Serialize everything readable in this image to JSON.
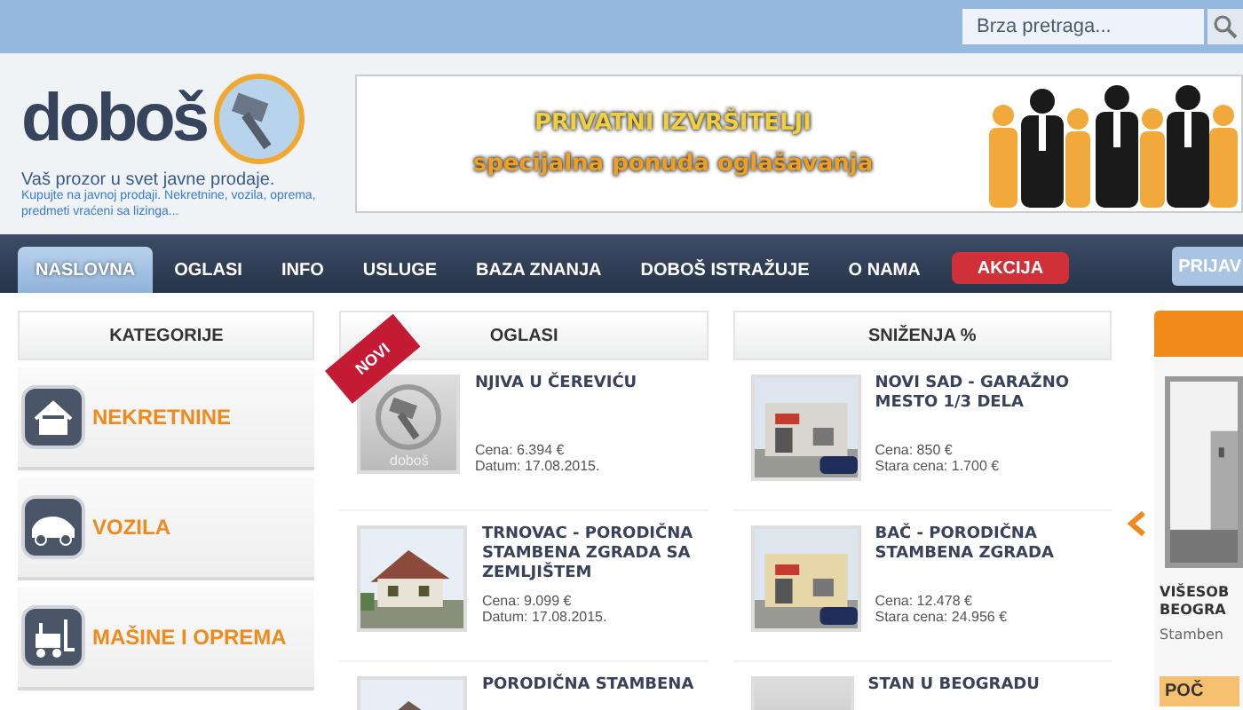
{
  "search": {
    "placeholder": "Brza pretraga..."
  },
  "logo": {
    "name": "doboš",
    "tagline": "Vaš prozor u svet javne prodaje.",
    "subtext": "Kupujte na javnoj prodaji. Nekretnine, vozila, oprema, predmeti vraćeni sa lizinga..."
  },
  "banner": {
    "title": "PRIVATNI IZVRŠITELJI",
    "subtitle": "specijalna ponuda oglašavanja"
  },
  "nav": [
    {
      "label": "NASLOVNA",
      "selected": true,
      "kind": "link"
    },
    {
      "label": "OGLASI",
      "selected": false,
      "kind": "link"
    },
    {
      "label": "INFO",
      "selected": false,
      "kind": "link"
    },
    {
      "label": "USLUGE",
      "selected": false,
      "kind": "link"
    },
    {
      "label": "BAZA ZNANJA",
      "selected": false,
      "kind": "link"
    },
    {
      "label": "DOBOŠ ISTRAŽUJE",
      "selected": false,
      "kind": "link"
    },
    {
      "label": "O NAMA",
      "selected": false,
      "kind": "link"
    },
    {
      "label": "AKCIJA",
      "selected": false,
      "kind": "promo"
    }
  ],
  "login": {
    "label": "PRIJAV"
  },
  "categories": {
    "title": "KATEGORIJE",
    "items": [
      {
        "label": "NEKRETNINE",
        "kind": "house"
      },
      {
        "label": "VOZILA",
        "kind": "car"
      },
      {
        "label": "MAŠINE I OPREMA",
        "kind": "forklift"
      }
    ]
  },
  "ads": {
    "title": "OGLASI",
    "ribbon": "NOVI",
    "items": [
      {
        "title": "NJIVA U ČEREVIĆU",
        "thumb": {
          "kind": "placeholder",
          "label": "doboš"
        },
        "line_1": "Cena: 6.394 €",
        "line_2": "Datum: 17.08.2015."
      },
      {
        "title": "TRNOVAC - PORODIČNA STAMBENA ZGRADA SA ZEMLJIŠTEM",
        "line_1": "Cena: 9.099 €",
        "line_2": "Datum: 17.08.2015."
      },
      {
        "title": "PORODIČNA STAMBENA"
      }
    ]
  },
  "discounts": {
    "title": "SNIŽENJA %",
    "items": [
      {
        "title": "NOVI SAD - GARAŽNO MESTO 1/3 DELA",
        "line_1": "Cena: 850 €",
        "line_2": "Stara cena: 1.700 €"
      },
      {
        "title": "BAČ - PORODIČNA STAMBENA ZGRADA",
        "line_1": "Cena: 12.478 €",
        "line_2": "Stara cena: 24.956 €"
      },
      {
        "title": "STAN U BEOGRADU",
        "thumb": {
          "kind": "placeholder"
        }
      }
    ]
  },
  "featured": {
    "title_1": "VIŠESOB",
    "title_2": "BEOGRA",
    "text": "Stamben",
    "button": "POČ"
  }
}
